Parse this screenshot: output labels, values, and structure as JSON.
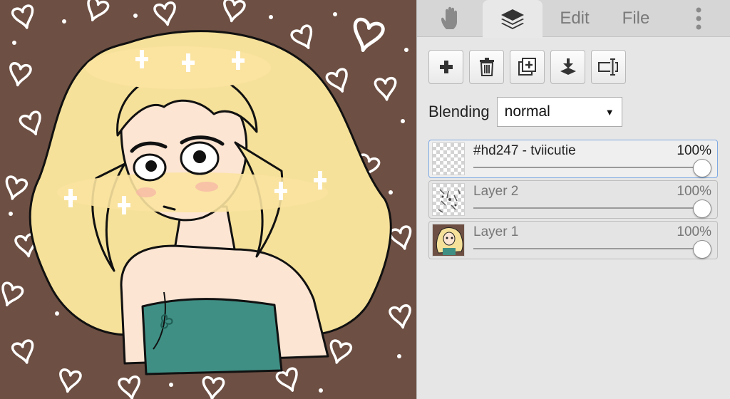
{
  "tabs": {
    "hand": {
      "icon": "hand-icon"
    },
    "layers": {
      "icon": "layers-icon"
    },
    "edit": {
      "label": "Edit"
    },
    "file": {
      "label": "File"
    },
    "more": {
      "icon": "more-vertical-icon"
    }
  },
  "toolbar": {
    "buttons": [
      "add-layer-icon",
      "delete-layer-icon",
      "duplicate-layer-icon",
      "merge-down-icon",
      "rename-layer-icon"
    ]
  },
  "blending": {
    "label": "Blending",
    "value": "normal"
  },
  "layers": [
    {
      "name": "#hd247 - tviicutie",
      "opacity": "100%",
      "selected": true
    },
    {
      "name": "Layer 2",
      "opacity": "100%",
      "selected": false
    },
    {
      "name": "Layer 1",
      "opacity": "100%",
      "selected": false
    }
  ],
  "colors": {
    "canvas_bg": "#6d4f43",
    "hair": "#f6e19a",
    "top": "#3f8f84",
    "skin": "#fde5d3",
    "selected_border": "#7ea9e3"
  }
}
